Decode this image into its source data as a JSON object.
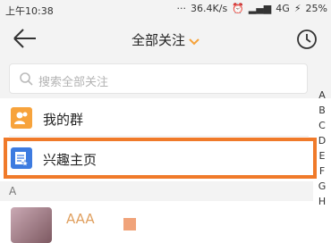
{
  "status_bar": {
    "time": "上午10:38",
    "dots": "···",
    "speed": "36.4K/s",
    "network": "4G",
    "battery": "25%"
  },
  "nav": {
    "title": "全部关注"
  },
  "search": {
    "placeholder": "搜索全部关注"
  },
  "rows": {
    "groups_label": "我的群",
    "interest_label": "兴趣主页"
  },
  "section": {
    "letter": "A"
  },
  "index_letters": [
    "A",
    "B",
    "C",
    "D",
    "E",
    "F",
    "G",
    "H"
  ],
  "user": {
    "name": "AAA"
  },
  "colors": {
    "highlight": "#f07a2a",
    "group_icon": "#f7a33c",
    "interest_icon": "#3d7be0",
    "accent_chevron": "#f5a23a"
  }
}
